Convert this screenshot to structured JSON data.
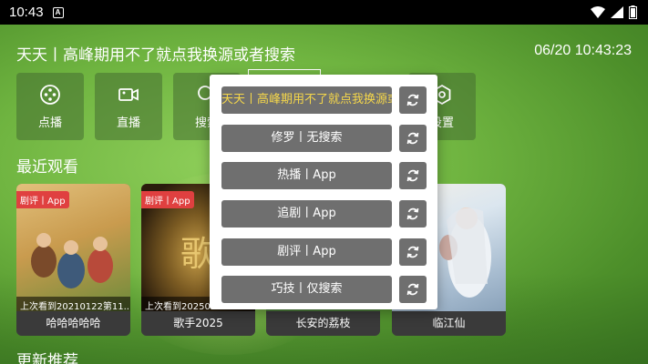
{
  "status_bar": {
    "time": "10:43",
    "notification_badge": "A"
  },
  "header": {
    "title": "天天丨高峰期用不了就点我换源或者搜索",
    "datetime": "06/20 10:43:23"
  },
  "nav": [
    {
      "label": "点播",
      "icon": "film-reel-icon"
    },
    {
      "label": "直播",
      "icon": "video-camera-icon"
    },
    {
      "label": "搜索",
      "icon": "search-icon"
    },
    {
      "label": "设置",
      "icon": "settings-icon"
    }
  ],
  "sections": {
    "recent": "最近观看",
    "update": "更新推荐"
  },
  "cards": [
    {
      "badge": "剧评丨App",
      "progress": "上次看到20210122第11...",
      "title": "哈哈哈哈哈",
      "poster_colors": [
        "#c99b4e",
        "#d9b872",
        "#6d8b3a"
      ]
    },
    {
      "badge": "剧评丨App",
      "progress": "上次看到2025092...",
      "title": "歌手2025",
      "poster_colors": [
        "#2a1c0c",
        "#7a5a22",
        "#c9a04a"
      ]
    },
    {
      "badge": "",
      "progress": "",
      "title": "长安的荔枝",
      "poster_colors": [
        "#4a7a3a",
        "#b9c28a",
        "#7ba25a"
      ]
    },
    {
      "badge": "",
      "progress": "",
      "title": "临江仙",
      "poster_colors": [
        "#dbe6ef",
        "#a7bcd0",
        "#e6dccb"
      ]
    }
  ],
  "source_dialog": {
    "sources": [
      {
        "label": "天天丨高峰期用不了就点我换源或者搜索",
        "active": true
      },
      {
        "label": "修罗丨无搜索",
        "active": false
      },
      {
        "label": "热播丨App",
        "active": false
      },
      {
        "label": "追剧丨App",
        "active": false
      },
      {
        "label": "剧评丨App",
        "active": false
      },
      {
        "label": "巧技丨仅搜索",
        "active": false
      }
    ],
    "refresh_icon": "refresh-icon"
  },
  "colors": {
    "accent": "#f5d74a",
    "badge": "#e04040",
    "button_bg": "#6f6f6f"
  }
}
